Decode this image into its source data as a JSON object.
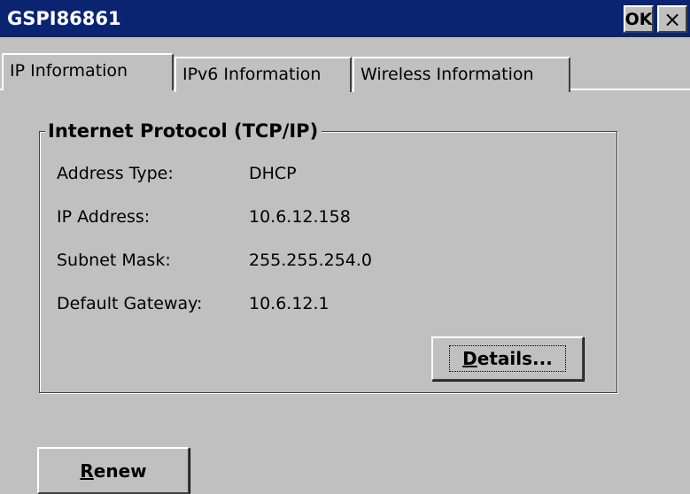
{
  "window": {
    "title": "GSPI86861",
    "ok_label": "OK",
    "close_label": "×"
  },
  "tabs": [
    {
      "label": "IP Information",
      "active": true
    },
    {
      "label": "IPv6 Information",
      "active": false
    },
    {
      "label": "Wireless Information",
      "active": false
    }
  ],
  "group": {
    "title": "Internet Protocol (TCP/IP)",
    "fields": [
      {
        "label": "Address Type:",
        "value": "DHCP"
      },
      {
        "label": "IP Address:",
        "value": "10.6.12.158"
      },
      {
        "label": "Subnet Mask:",
        "value": "255.255.254.0"
      },
      {
        "label": "Default Gateway:",
        "value": "10.6.12.1"
      }
    ]
  },
  "buttons": {
    "details_mnemonic": "D",
    "details_rest": "etails...",
    "renew_mnemonic": "R",
    "renew_rest": "enew"
  }
}
